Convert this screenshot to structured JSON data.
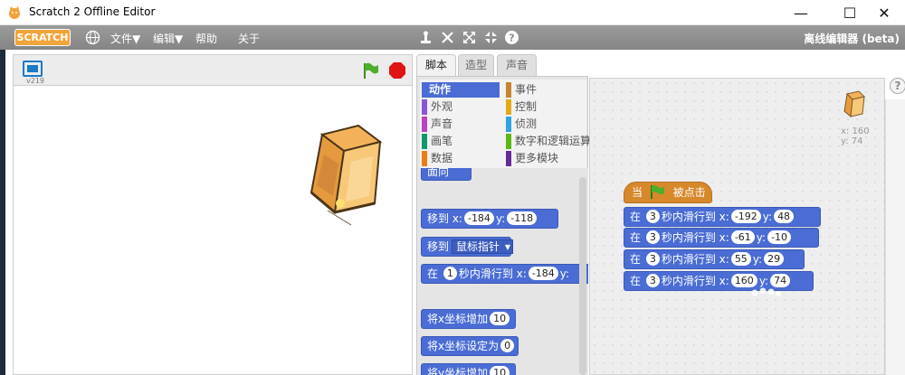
{
  "window": {
    "title": "Scratch 2 Offline Editor",
    "minimize_icon": "minimize-icon",
    "maximize_icon": "maximize-icon",
    "close_icon": "close-icon"
  },
  "menubar": {
    "logo": "SCRATCH",
    "file": "文件▼",
    "edit": "编辑▼",
    "help": "帮助",
    "about": "关于",
    "offline_label": "离线编辑器 (beta)",
    "tools": [
      "duplicate-icon",
      "delete-icon",
      "grow-icon",
      "shrink-icon",
      "help-icon"
    ]
  },
  "stage": {
    "version": "v219",
    "sprite": "lantern"
  },
  "tabs": [
    "脚本",
    "造型",
    "声音"
  ],
  "categories": {
    "left": [
      "动作",
      "外观",
      "声音",
      "画笔",
      "数据"
    ],
    "right": [
      "事件",
      "控制",
      "侦测",
      "数字和逻辑运算",
      "更多模块"
    ],
    "left_colors": [
      "#4a6cd4",
      "#8a55d7",
      "#bb42c3",
      "#0e9a6c",
      "#ee7d16"
    ],
    "right_colors": [
      "#c88330",
      "#e1a91a",
      "#2ca5e2",
      "#5cb712",
      "#632d99"
    ],
    "selected": "动作"
  },
  "palette_blocks": {
    "partial_top": "面向",
    "goto_xy": {
      "label": "移到 x:",
      "x": "-184",
      "ylabel": "y:",
      "y": "-118"
    },
    "goto_target": {
      "label": "移到",
      "dropdown": "鼠标指针"
    },
    "glide": {
      "prefix": "在",
      "secs": "1",
      "mid": "秒内滑行到 x:",
      "x": "-184",
      "ylabel": "y:"
    },
    "change_x": {
      "label": "将x坐标增加",
      "value": "10"
    },
    "set_x": {
      "label": "将x坐标设定为",
      "value": "0"
    },
    "change_y": {
      "label": "将y坐标增加",
      "value": "10"
    }
  },
  "script": {
    "hat": {
      "prefix": "当",
      "suffix": "被点击"
    },
    "glides": [
      {
        "prefix": "在",
        "secs": "3",
        "mid": "秒内滑行到 x:",
        "x": "-192",
        "ylabel": "y:",
        "y": "48"
      },
      {
        "prefix": "在",
        "secs": "3",
        "mid": "秒内滑行到 x:",
        "x": "-61",
        "ylabel": "y:",
        "y": "-10"
      },
      {
        "prefix": "在",
        "secs": "3",
        "mid": "秒内滑行到 x:",
        "x": "55",
        "ylabel": "y:",
        "y": "29"
      },
      {
        "prefix": "在",
        "secs": "3",
        "mid": "秒内滑行到 x:",
        "x": "160",
        "ylabel": "y:",
        "y": "74"
      }
    ]
  },
  "sprite_info": {
    "x": "x: 160",
    "y": "y: 74"
  },
  "help": "?"
}
